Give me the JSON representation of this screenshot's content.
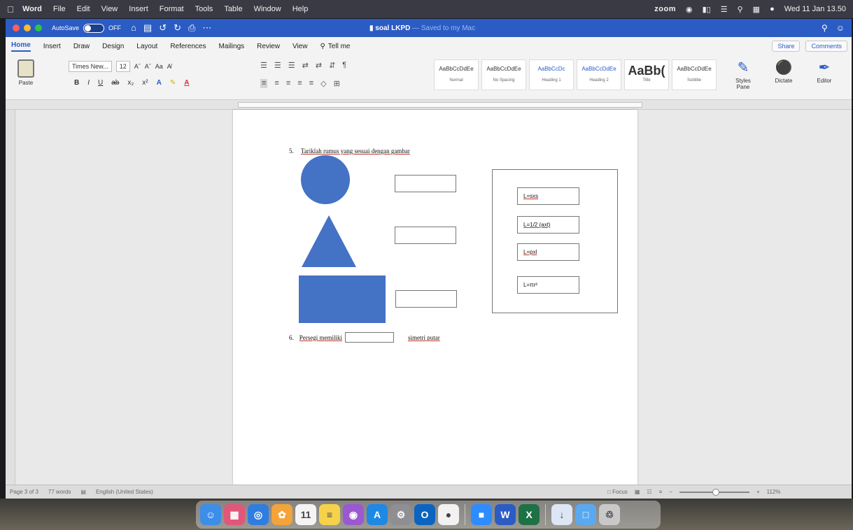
{
  "menubar": {
    "apple_icon": "apple-icon",
    "app_name": "Word",
    "items": [
      "File",
      "Edit",
      "View",
      "Insert",
      "Format",
      "Tools",
      "Table",
      "Window",
      "Help"
    ],
    "zoom_label": "zoom",
    "datetime": "Wed 11 Jan 13.50"
  },
  "titlebar": {
    "autosave_label": "AutoSave",
    "autosave_state": "OFF",
    "doc_name": "soal LKPD",
    "saved_status": " — Saved to my Mac"
  },
  "ribbon": {
    "tabs": [
      "Home",
      "Insert",
      "Draw",
      "Design",
      "Layout",
      "References",
      "Mailings",
      "Review",
      "View"
    ],
    "tell_me": "Tell me",
    "share": "Share",
    "comments": "Comments",
    "paste_label": "Paste",
    "font_name": "Times New...",
    "font_size": "12",
    "font_buttons": [
      "Aˆ",
      "Aˇ",
      "Aa",
      "A̸"
    ],
    "format_buttons": [
      "B",
      "I",
      "U",
      "ab",
      "x₂",
      "x²",
      "A",
      "✎",
      "A"
    ],
    "para_row1": [
      "☰",
      "☰",
      "☰",
      "⇄",
      "⇄",
      "⇵",
      "¶"
    ],
    "para_row2": [
      "≡",
      "≡",
      "≡",
      "≡",
      "≡",
      "◇",
      "⊞"
    ],
    "styles": [
      {
        "sample": "AaBbCcDdEe",
        "name": "Normal"
      },
      {
        "sample": "AaBbCcDdEe",
        "name": "No Spacing"
      },
      {
        "sample": "AaBbCcDc",
        "name": "Heading 1"
      },
      {
        "sample": "AaBbCcDdEe",
        "name": "Heading 2"
      },
      {
        "sample": "AaBb(",
        "name": "Title"
      },
      {
        "sample": "AaBbCcDdEe",
        "name": "Subtitle"
      }
    ],
    "styles_pane": "Styles Pane",
    "dictate": "Dictate",
    "editor": "Editor"
  },
  "document": {
    "q5_number": "5.",
    "q5_text": "Tariklah rumus yang sesuai dengan gambar",
    "formulas": [
      "L=sxs",
      "L=1/2 (axt)",
      "L=pxl",
      "L=πr²"
    ],
    "q6_number": "6.",
    "q6_text_before": "Persegi memiliki",
    "q6_text_after": "simetri putar",
    "shape_color": "#4472c4"
  },
  "statusbar": {
    "page": "Page 3 of 3",
    "words": "77 words",
    "language": "English (United States)",
    "focus": "Focus",
    "zoom_minus": "−",
    "zoom_plus": "+",
    "zoom_percent": "112%",
    "zoom_level": 0.52
  },
  "dock": {
    "apps": [
      {
        "name": "finder-icon",
        "color": "#3d8ee8",
        "glyph": "☺"
      },
      {
        "name": "launchpad-icon",
        "color": "#e0577a",
        "glyph": "▦"
      },
      {
        "name": "safari-icon",
        "color": "#2f7de1",
        "glyph": "◎"
      },
      {
        "name": "photos-icon",
        "color": "#f2a33a",
        "glyph": "✿"
      },
      {
        "name": "calendar-icon",
        "color": "#f4f4f4",
        "glyph": "11"
      },
      {
        "name": "notes-icon",
        "color": "#f6d24b",
        "glyph": "≡"
      },
      {
        "name": "podcasts-icon",
        "color": "#9b59d0",
        "glyph": "◉"
      },
      {
        "name": "app-store-icon",
        "color": "#1e88e5",
        "glyph": "A"
      },
      {
        "name": "settings-icon",
        "color": "#8e8e93",
        "glyph": "⚙"
      },
      {
        "name": "outlook-icon",
        "color": "#0b64c0",
        "glyph": "O"
      },
      {
        "name": "chrome-icon",
        "color": "#f2f2f2",
        "glyph": "●"
      },
      {
        "name": "zoom-app-icon",
        "color": "#2d8cff",
        "glyph": "■"
      },
      {
        "name": "word-app-icon",
        "color": "#2b5cc4",
        "glyph": "W"
      },
      {
        "name": "excel-app-icon",
        "color": "#1e7145",
        "glyph": "X"
      },
      {
        "name": "downloads-icon",
        "color": "#dce6f5",
        "glyph": "↓"
      },
      {
        "name": "folder-icon",
        "color": "#5aa9f0",
        "glyph": "□"
      },
      {
        "name": "trash-icon",
        "color": "#c9c9c9",
        "glyph": "♲"
      }
    ]
  }
}
